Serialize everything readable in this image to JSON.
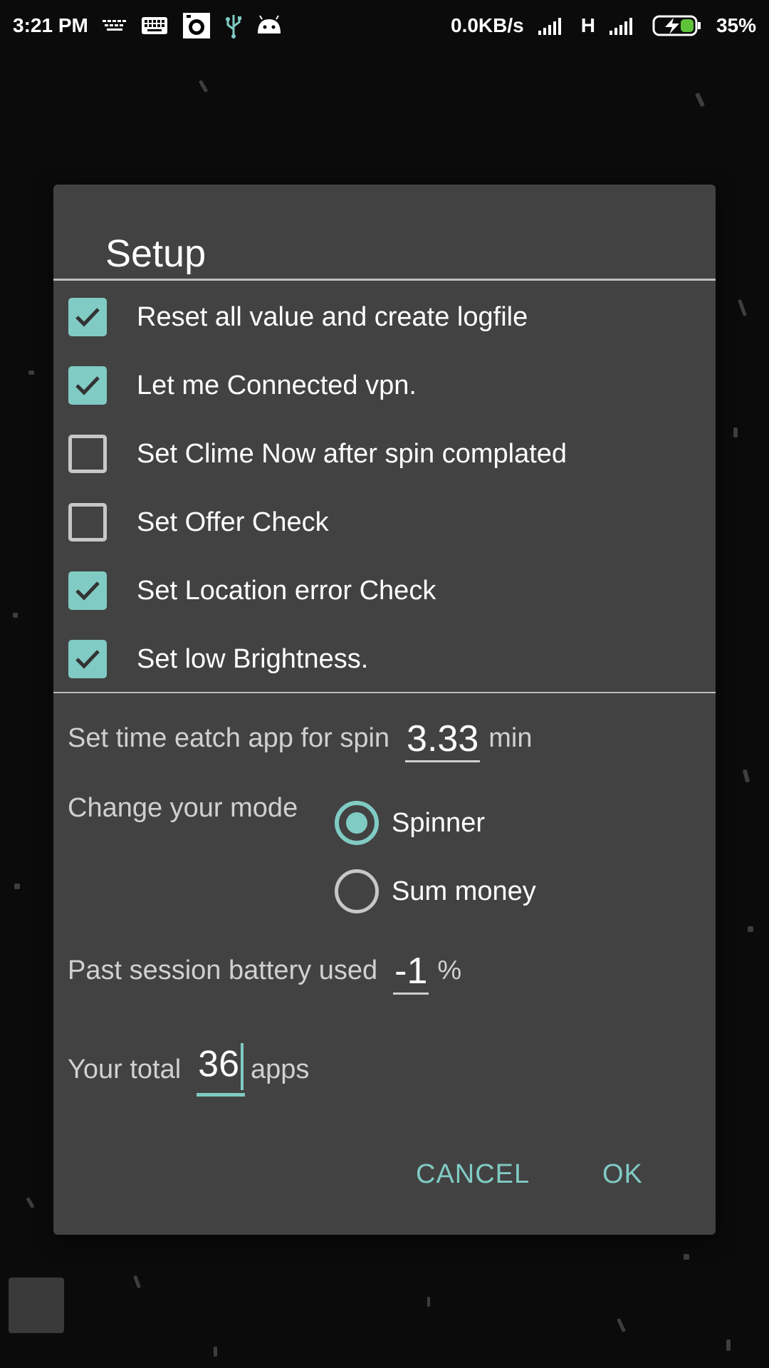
{
  "status_bar": {
    "time": "3:21 PM",
    "net_speed": "0.0KB/s",
    "network_type": "H",
    "battery": "35%",
    "icons_left": [
      "keyboard-small-icon",
      "keyboard-icon",
      "camera-icon",
      "usb-icon",
      "android-icon"
    ],
    "icons_right": [
      "signal-icon",
      "signal-icon",
      "battery-charging-icon"
    ]
  },
  "dialog": {
    "title": "Setup",
    "options": [
      {
        "label": "Reset all value and create logfile",
        "checked": true
      },
      {
        "label": "Let me Connected vpn.",
        "checked": true
      },
      {
        "label": "Set Clime Now after spin complated",
        "checked": false
      },
      {
        "label": "Set Offer Check",
        "checked": false
      },
      {
        "label": "Set Location error Check",
        "checked": true
      },
      {
        "label": "Set low Brightness.",
        "checked": true
      }
    ],
    "spin_time": {
      "label": "Set time eatch app for spin",
      "value": "3.33",
      "unit": "min"
    },
    "mode": {
      "label": "Change your mode",
      "options": [
        {
          "label": "Spinner",
          "selected": true
        },
        {
          "label": "Sum money",
          "selected": false
        }
      ]
    },
    "battery": {
      "label": "Past session battery used",
      "value": "-1",
      "unit": "%"
    },
    "total": {
      "label": "Your total",
      "value": "36",
      "unit": "apps"
    },
    "buttons": {
      "cancel": "CANCEL",
      "ok": "OK"
    }
  },
  "colors": {
    "accent": "#80cbc4",
    "dialog_bg": "#424242",
    "background": "#0b0b0b"
  }
}
